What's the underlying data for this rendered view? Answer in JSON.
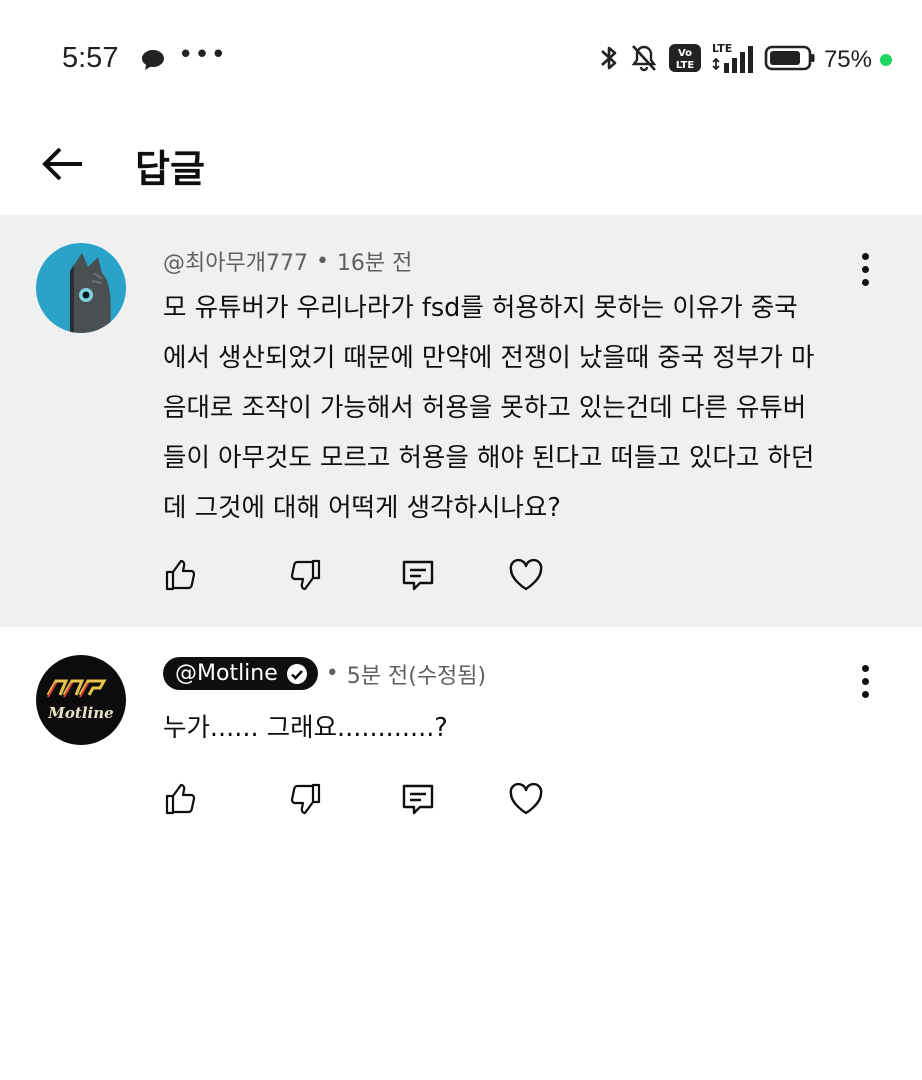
{
  "status_bar": {
    "time": "5:57",
    "network": "LTE",
    "volte": "Vo LTE",
    "battery": "75%"
  },
  "header": {
    "title": "답글"
  },
  "comments": [
    {
      "author": "@최아무개777",
      "separator": "•",
      "time": "16분 전",
      "text": "모 유튜버가 우리나라가 fsd를 허용하지 못하는 이유가 중국\n에서 생산되었기 때문에 만약에 전쟁이 났을때 중국 정부가 마\n음대로 조작이 가능해서 허용을 못하고 있는건데 다른 유튜버\n들이 아무것도 모르고 허용을 해야 된다고 떠들고 있다고 하던\n데 그것에 대해 어떡게 생각하시나요?",
      "highlighted": true
    },
    {
      "author": "@Motline",
      "verified": true,
      "separator": "•",
      "time": "5분 전(수정됨)",
      "text": "누가...... 그래요............?",
      "highlighted": false,
      "avatar_text": "Motline"
    }
  ],
  "colors": {
    "highlight_bg": "#f0f0f0",
    "meta_text": "#606060",
    "primary_text": "#0f0f0f",
    "battery_dot": "#1ed760"
  },
  "icons": [
    "back-arrow-icon",
    "more-vert-icon",
    "like-icon",
    "dislike-icon",
    "reply-icon",
    "heart-icon",
    "verified-icon"
  ]
}
